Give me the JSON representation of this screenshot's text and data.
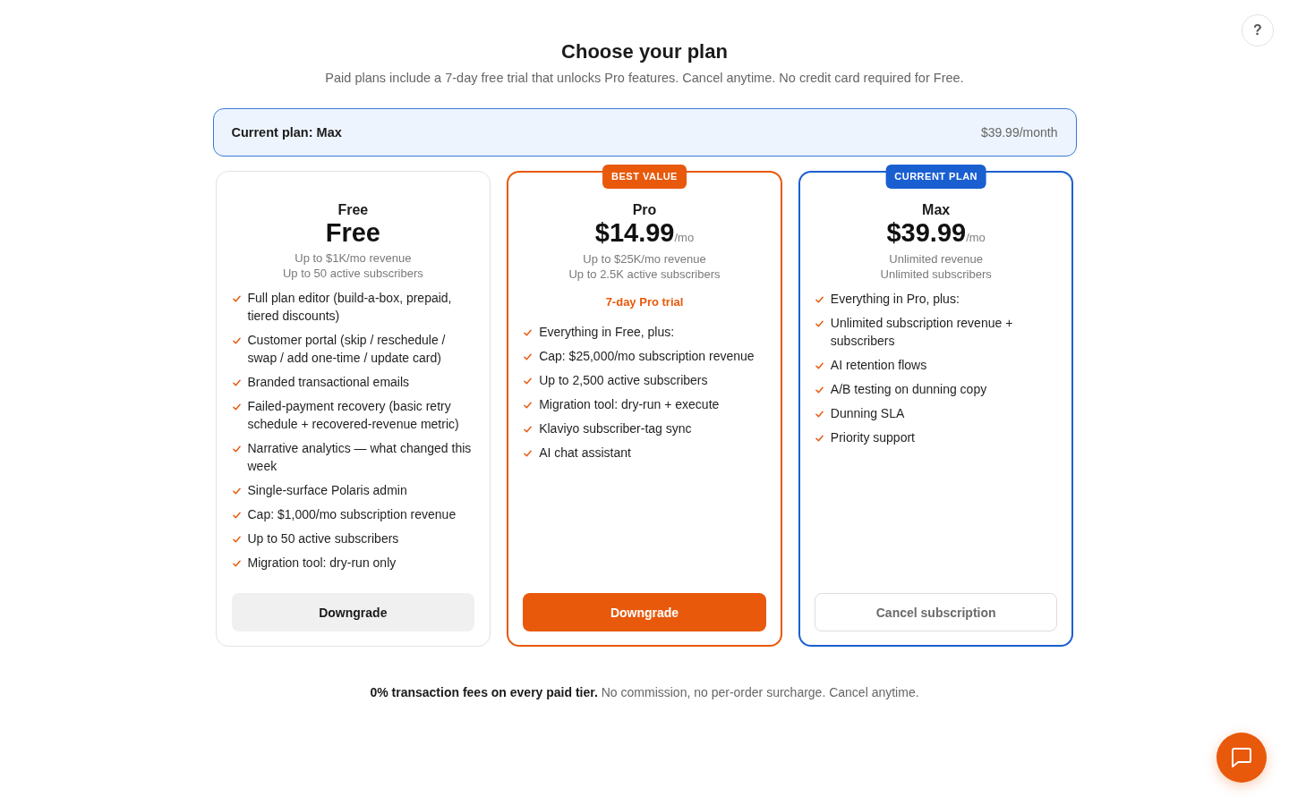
{
  "help_button": {
    "label": "?"
  },
  "header": {
    "title": "Choose your plan",
    "subtitle": "Paid plans include a 7-day free trial that unlocks Pro features. Cancel anytime. No credit card required for Free."
  },
  "current_plan_banner": {
    "label": "Current plan: Max",
    "price": "$39.99/month"
  },
  "plans": [
    {
      "kind": "basic",
      "name": "Free",
      "price": "Free",
      "limits": [
        "Up to $1K/mo revenue",
        "Up to 50 active subscribers"
      ],
      "features": [
        "Full plan editor (build-a-box, prepaid, tiered discounts)",
        "Customer portal (skip / reschedule / swap / add one-time / update card)",
        "Branded transactional emails",
        "Failed-payment recovery (basic retry schedule + recovered-revenue metric)",
        "Narrative analytics — what changed this week",
        "Single-surface Polaris admin",
        "Cap: $1,000/mo subscription revenue",
        "Up to 50 active subscribers",
        "Migration tool: dry-run only"
      ],
      "action": {
        "label": "Downgrade",
        "kind": "secondary"
      }
    },
    {
      "kind": "featured",
      "badge": "BEST VALUE",
      "name": "Pro",
      "price": "$14.99",
      "unit": "/mo",
      "limits": [
        "Up to $25K/mo revenue",
        "Up to 2.5K active subscribers"
      ],
      "trial": "7-day Pro trial",
      "features": [
        "Everything in Free, plus:",
        "Cap: $25,000/mo subscription revenue",
        "Up to 2,500 active subscribers",
        "Migration tool: dry-run + execute",
        "Klaviyo subscriber-tag sync",
        "AI chat assistant"
      ],
      "action": {
        "label": "Downgrade",
        "kind": "primary"
      }
    },
    {
      "kind": "current",
      "badge": "CURRENT PLAN",
      "name": "Max",
      "price": "$39.99",
      "unit": "/mo",
      "limits": [
        "Unlimited revenue",
        "Unlimited subscribers"
      ],
      "features": [
        "Everything in Pro, plus:",
        "Unlimited subscription revenue + subscribers",
        "AI retention flows",
        "A/B testing on dunning copy",
        "Dunning SLA",
        "Priority support"
      ],
      "action": {
        "label": "Cancel subscription",
        "kind": "outline"
      }
    }
  ],
  "footer_note": "**0% transaction fees on every paid tier.** No commission, no per-order surcharge. Cancel anytime."
}
